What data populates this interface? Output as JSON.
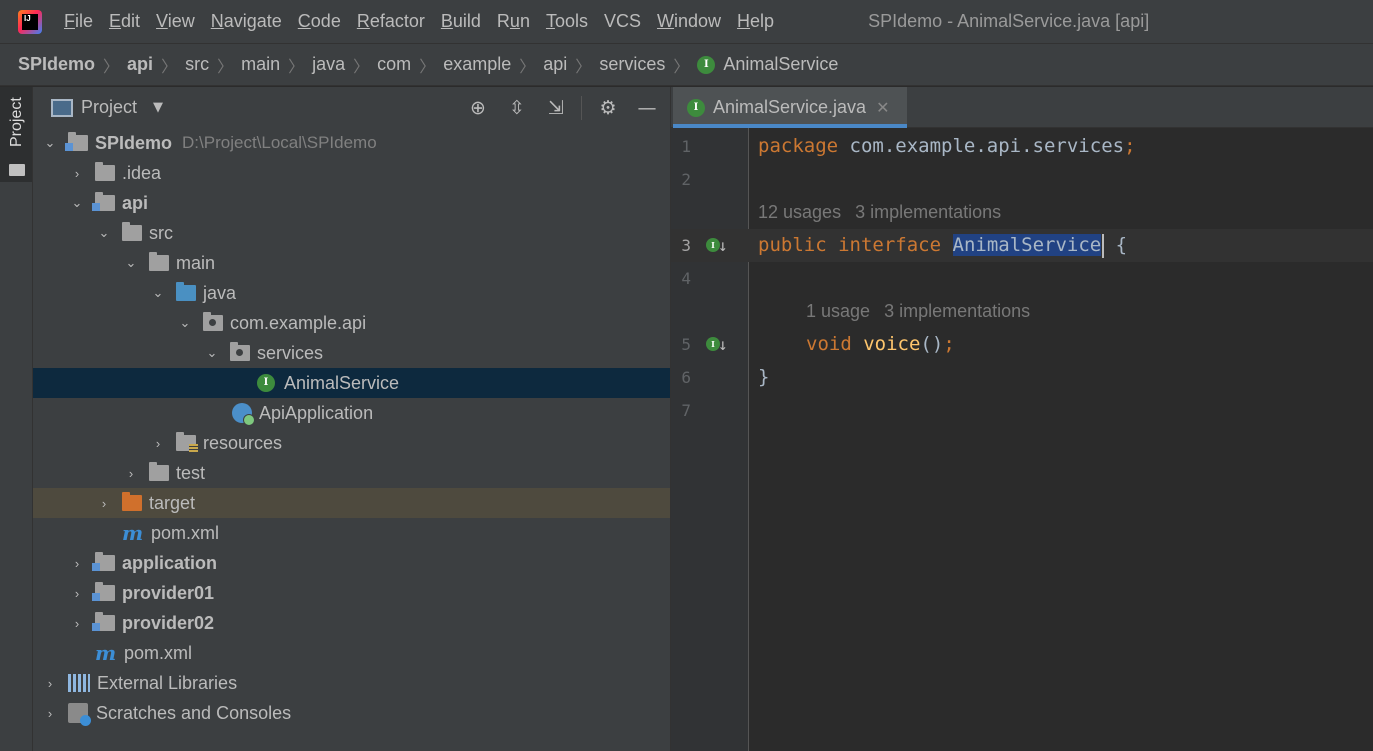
{
  "menu": {
    "items": [
      {
        "pre": "",
        "ul": "F",
        "post": "ile"
      },
      {
        "pre": "",
        "ul": "E",
        "post": "dit"
      },
      {
        "pre": "",
        "ul": "V",
        "post": "iew"
      },
      {
        "pre": "",
        "ul": "N",
        "post": "avigate"
      },
      {
        "pre": "",
        "ul": "C",
        "post": "ode"
      },
      {
        "pre": "",
        "ul": "R",
        "post": "efactor"
      },
      {
        "pre": "",
        "ul": "B",
        "post": "uild"
      },
      {
        "pre": "R",
        "ul": "u",
        "post": "n"
      },
      {
        "pre": "",
        "ul": "T",
        "post": "ools"
      },
      {
        "pre": "VC",
        "ul": "",
        "post": "S"
      },
      {
        "pre": "",
        "ul": "W",
        "post": "indow"
      },
      {
        "pre": "",
        "ul": "H",
        "post": "elp"
      }
    ],
    "window_title": "SPIdemo - AnimalService.java [api]"
  },
  "breadcrumb": {
    "items": [
      "SPIdemo",
      "api",
      "src",
      "main",
      "java",
      "com",
      "example",
      "api",
      "services"
    ],
    "current": "AnimalService",
    "interface_badge": "I"
  },
  "side_strip": {
    "tab_label": "Project"
  },
  "project_panel": {
    "title": "Project",
    "tree": {
      "root": {
        "label": "SPIdemo",
        "path": "D:\\Project\\Local\\SPIdemo"
      },
      "idea": ".idea",
      "api": "api",
      "src": "src",
      "main": "main",
      "java": "java",
      "pkg": "com.example.api",
      "services": "services",
      "animal_service": "AnimalService",
      "api_application": "ApiApplication",
      "resources": "resources",
      "test": "test",
      "target": "target",
      "api_pom": "pom.xml",
      "application": "application",
      "provider01": "provider01",
      "provider02": "provider02",
      "root_pom": "pom.xml",
      "external_libraries": "External Libraries",
      "scratches": "Scratches and Consoles"
    }
  },
  "editor": {
    "tab_label": "AnimalService.java",
    "lines": [
      "1",
      "2",
      "3",
      "4",
      "5",
      "6",
      "7"
    ],
    "code": {
      "l1_kw": "package",
      "l1_name": "com.example.api.services",
      "l1_semi": ";",
      "hint1_usages": "12 usages",
      "hint1_impls": "3 implementations",
      "l3_kw1": "public",
      "l3_kw2": "interface",
      "l3_name": "AnimalService",
      "l3_brace": "{",
      "hint2_usages": "1 usage",
      "hint2_impls": "3 implementations",
      "l5_kw": "void",
      "l5_fn": "voice",
      "l5_parens": "()",
      "l5_semi": ";",
      "l6_brace": "}"
    }
  }
}
